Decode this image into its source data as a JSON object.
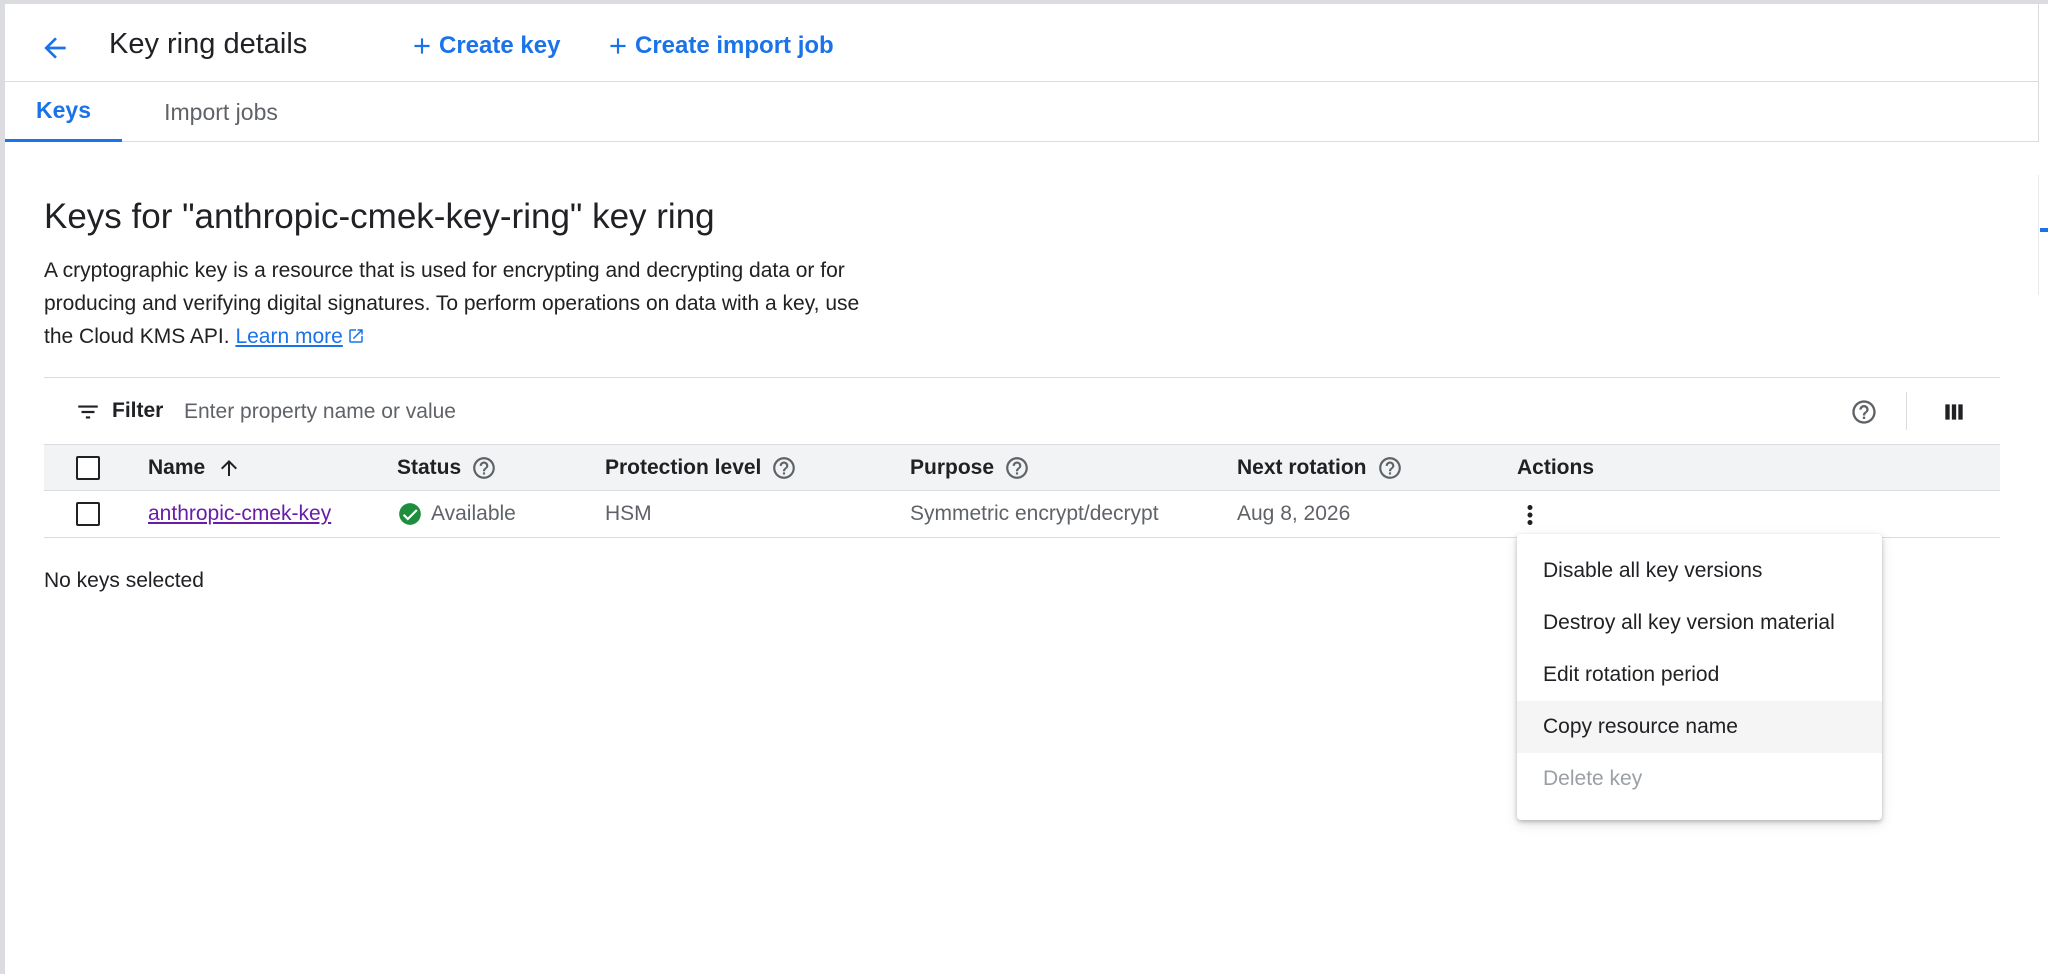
{
  "header": {
    "title": "Key ring details",
    "create_key_label": "Create key",
    "create_import_job_label": "Create import job"
  },
  "tabs": [
    {
      "label": "Keys",
      "active": true
    },
    {
      "label": "Import jobs",
      "active": false
    }
  ],
  "section": {
    "title": "Keys for \"anthropic-cmek-key-ring\" key ring",
    "description": "A cryptographic key is a resource that is used for encrypting and decrypting data or for producing and verifying digital signatures. To perform operations on data with a key, use the Cloud KMS API.",
    "learn_more_label": "Learn more"
  },
  "filter": {
    "label": "Filter",
    "placeholder": "Enter property name or value"
  },
  "table": {
    "columns": {
      "name": "Name",
      "status": "Status",
      "protection_level": "Protection level",
      "purpose": "Purpose",
      "next_rotation": "Next rotation",
      "actions": "Actions"
    },
    "rows": [
      {
        "name": "anthropic-cmek-key",
        "status": "Available",
        "protection_level": "HSM",
        "purpose": "Symmetric encrypt/decrypt",
        "next_rotation": "Aug 8, 2026"
      }
    ]
  },
  "selection_status": "No keys selected",
  "actions_menu": {
    "items": [
      {
        "label": "Disable all key versions",
        "disabled": false
      },
      {
        "label": "Destroy all key version material",
        "disabled": false
      },
      {
        "label": "Edit rotation period",
        "disabled": false
      },
      {
        "label": "Copy resource name",
        "disabled": false,
        "hovered": true
      },
      {
        "label": "Delete key",
        "disabled": true
      }
    ]
  },
  "colors": {
    "accent": "#1a73e8",
    "link_visited": "#681da8",
    "success": "#1e8e3e",
    "header_bg": "#f1f3f4"
  },
  "icons": [
    "arrow-back-icon",
    "add-icon",
    "filter-list-icon",
    "help-icon",
    "column-display-icon",
    "arrow-upward-icon",
    "check-circle-icon",
    "more-vert-icon",
    "open-in-new-icon"
  ]
}
